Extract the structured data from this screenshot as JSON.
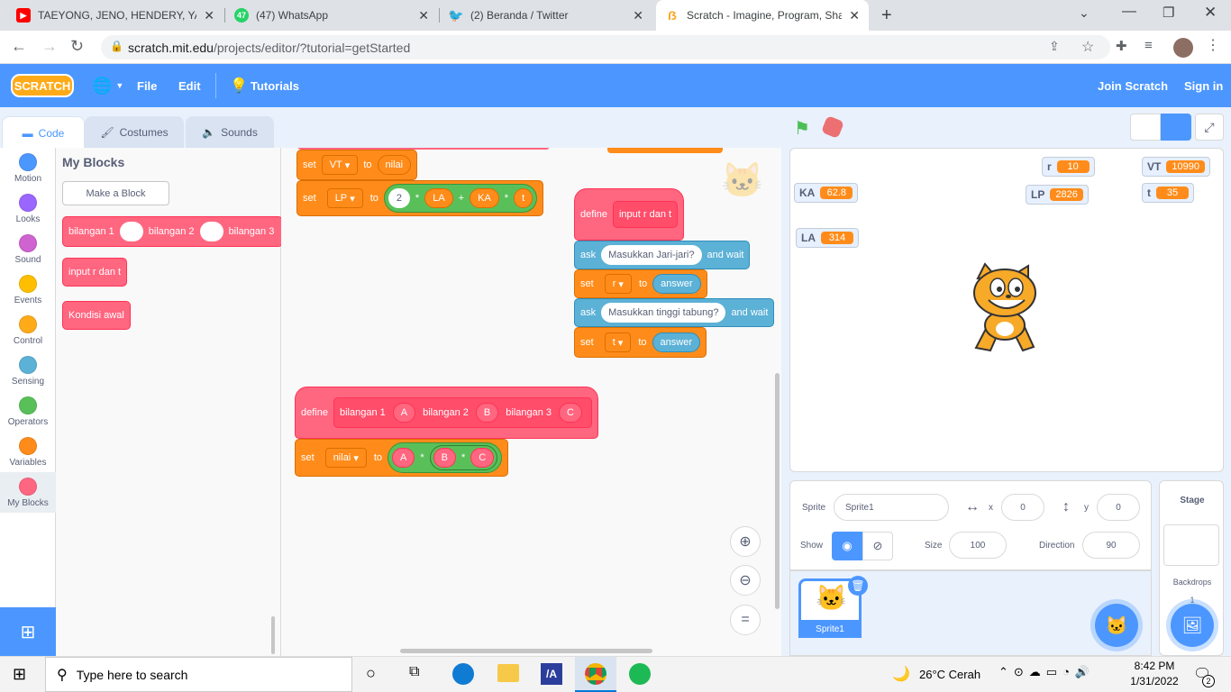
{
  "browser": {
    "tabs": [
      {
        "title": "TAEYONG, JENO, HENDERY, YANG",
        "favicon_color": "#ff0000",
        "favicon": "yt"
      },
      {
        "title": "(47) WhatsApp",
        "favicon_color": "#25d366",
        "favicon": "47"
      },
      {
        "title": "(2) Beranda / Twitter",
        "favicon_color": "#1da1f2",
        "favicon": "tw"
      },
      {
        "title": "Scratch - Imagine, Program, Shar",
        "favicon_color": "#f9a825",
        "favicon": "S"
      }
    ],
    "url_host": "scratch.mit.edu",
    "url_path": "/projects/editor/?tutorial=getStarted"
  },
  "menubar": {
    "logo": "SCRATCH",
    "file": "File",
    "edit": "Edit",
    "tutorials": "Tutorials",
    "join": "Join Scratch",
    "signin": "Sign in"
  },
  "editor_tabs": {
    "code": "Code",
    "costumes": "Costumes",
    "sounds": "Sounds"
  },
  "categories": [
    {
      "label": "Motion",
      "color": "#4c97ff"
    },
    {
      "label": "Looks",
      "color": "#9966ff"
    },
    {
      "label": "Sound",
      "color": "#cf63cf"
    },
    {
      "label": "Events",
      "color": "#ffbf00"
    },
    {
      "label": "Control",
      "color": "#ffab19"
    },
    {
      "label": "Sensing",
      "color": "#5cb1d6"
    },
    {
      "label": "Operators",
      "color": "#59c059"
    },
    {
      "label": "Variables",
      "color": "#ff8c1a"
    },
    {
      "label": "My Blocks",
      "color": "#ff6680"
    }
  ],
  "palette": {
    "title": "My Blocks",
    "make_block": "Make a Block",
    "block1": {
      "a": "bilangan 1",
      "b": "bilangan 2",
      "c": "bilangan 3"
    },
    "block2": "input r dan t",
    "block3": "Kondisi awal"
  },
  "workspace": {
    "set_vt": {
      "set": "set",
      "var": "VT",
      "to": "to",
      "val": "nilai"
    },
    "set_lp": {
      "set": "set",
      "var": "LP",
      "to": "to",
      "n": "2",
      "mul": "*",
      "la": "LA",
      "plus": "+",
      "ka": "KA",
      "mul2": "*",
      "t": "t"
    },
    "define1": {
      "define": "define",
      "name": "input r dan t"
    },
    "ask1": {
      "ask": "ask",
      "q": "Masukkan Jari-jari?",
      "wait": "and wait"
    },
    "set_r": {
      "set": "set",
      "var": "r",
      "to": "to",
      "val": "answer"
    },
    "ask2": {
      "ask": "ask",
      "q": "Masukkan tinggi tabung?",
      "wait": "and wait"
    },
    "set_t": {
      "set": "set",
      "var": "t",
      "to": "to",
      "val": "answer"
    },
    "define2": {
      "define": "define",
      "a": "bilangan 1",
      "A": "A",
      "b": "bilangan 2",
      "B": "B",
      "c": "bilangan 3",
      "C": "C"
    },
    "set_nilai": {
      "set": "set",
      "var": "nilai",
      "to": "to",
      "A": "A",
      "mul": "*",
      "B": "B",
      "mul2": "*",
      "C": "C"
    },
    "zoom_reset": "="
  },
  "monitors": {
    "r": {
      "name": "r",
      "value": "10"
    },
    "VT": {
      "name": "VT",
      "value": "10990"
    },
    "KA": {
      "name": "KA",
      "value": "62.8"
    },
    "LP": {
      "name": "LP",
      "value": "2826"
    },
    "t": {
      "name": "t",
      "value": "35"
    },
    "LA": {
      "name": "LA",
      "value": "314"
    }
  },
  "sprite_info": {
    "sprite_label": "Sprite",
    "sprite_name": "Sprite1",
    "x_label": "x",
    "x": "0",
    "y_label": "y",
    "y": "0",
    "show_label": "Show",
    "size_label": "Size",
    "size": "100",
    "direction_label": "Direction",
    "direction": "90",
    "thumb_name": "Sprite1"
  },
  "stage_pane": {
    "title": "Stage",
    "backdrops_label": "Backdrops",
    "backdrops_count": "1"
  },
  "taskbar": {
    "search_placeholder": "Type here to search",
    "weather": "26°C  Cerah",
    "time": "8:42 PM",
    "date": "1/31/2022",
    "notif_count": "2"
  }
}
